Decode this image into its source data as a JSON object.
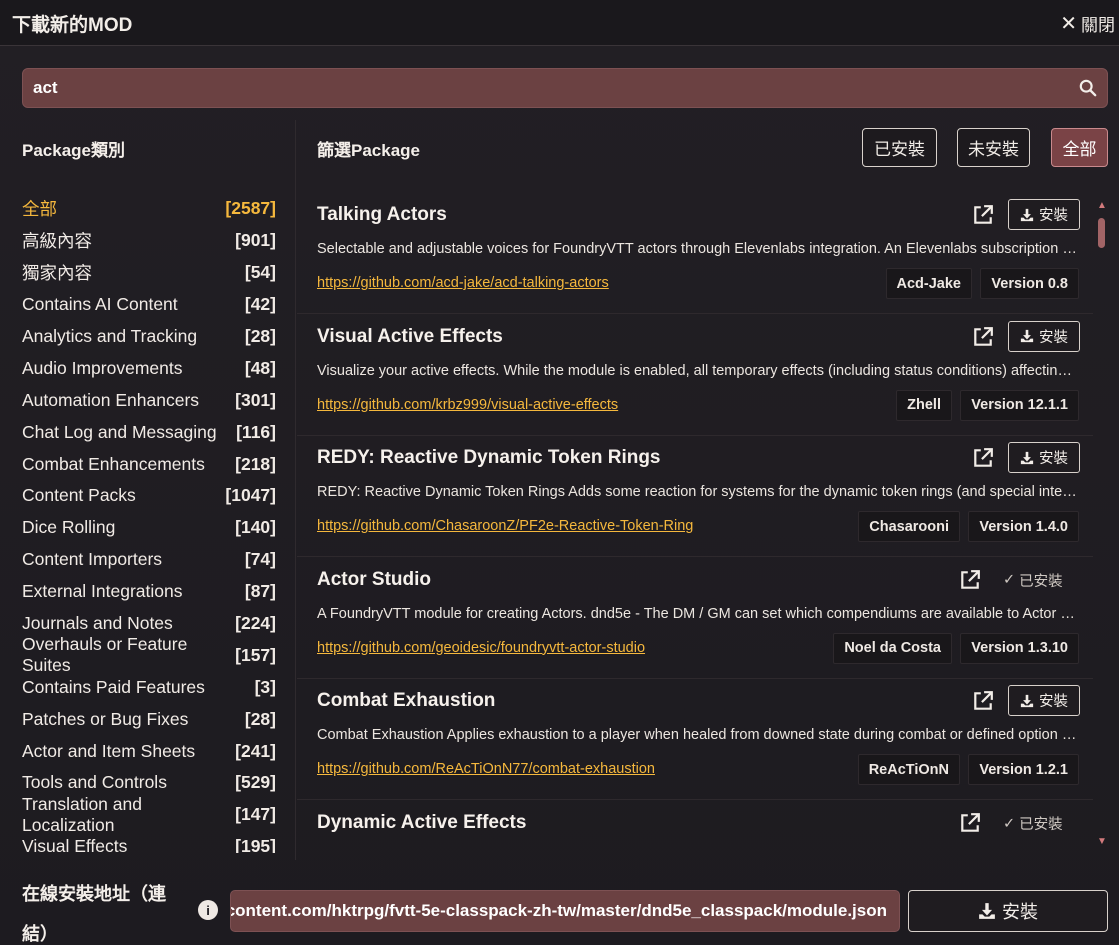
{
  "header": {
    "title": "下載新的MOD",
    "close_label": "關閉"
  },
  "search": {
    "value": "act"
  },
  "left": {
    "heading": "Package類別",
    "categories": [
      {
        "label": "全部",
        "count": "[2587]",
        "active": true
      },
      {
        "label": "高級內容",
        "count": "[901]"
      },
      {
        "label": "獨家內容",
        "count": "[54]"
      },
      {
        "label": "Contains AI Content",
        "count": "[42]"
      },
      {
        "label": "Analytics and Tracking",
        "count": "[28]"
      },
      {
        "label": "Audio Improvements",
        "count": "[48]"
      },
      {
        "label": "Automation Enhancers",
        "count": "[301]"
      },
      {
        "label": "Chat Log and Messaging",
        "count": "[116]"
      },
      {
        "label": "Combat Enhancements",
        "count": "[218]"
      },
      {
        "label": "Content Packs",
        "count": "[1047]"
      },
      {
        "label": "Dice Rolling",
        "count": "[140]"
      },
      {
        "label": "Content Importers",
        "count": "[74]"
      },
      {
        "label": "External Integrations",
        "count": "[87]"
      },
      {
        "label": "Journals and Notes",
        "count": "[224]"
      },
      {
        "label": "Overhauls or Feature Suites",
        "count": "[157]"
      },
      {
        "label": "Contains Paid Features",
        "count": "[3]"
      },
      {
        "label": "Patches or Bug Fixes",
        "count": "[28]"
      },
      {
        "label": "Actor and Item Sheets",
        "count": "[241]"
      },
      {
        "label": "Tools and Controls",
        "count": "[529]"
      },
      {
        "label": "Translation and Localization",
        "count": "[147]"
      },
      {
        "label": "Visual Effects",
        "count": "[195]"
      }
    ]
  },
  "right": {
    "heading": "篩選Package",
    "filters": {
      "installed": "已安裝",
      "not_installed": "未安裝",
      "all": "全部"
    },
    "install_label": "安裝",
    "installed_label": "已安裝",
    "packages": [
      {
        "name": "Talking Actors",
        "description": "Selectable and adjustable voices for FoundryVTT actors through Elevenlabs integration. An Elevenlabs subscription is required.",
        "url": "https://github.com/acd-jake/acd-talking-actors",
        "author": "Acd-Jake",
        "version": "Version 0.8",
        "installed": false
      },
      {
        "name": "Visual Active Effects",
        "description": "Visualize your active effects. While the module is enabled, all temporary effects (including status conditions) affecting the token are shown.",
        "url": "https://github.com/krbz999/visual-active-effects",
        "author": "Zhell",
        "version": "Version 12.1.1",
        "installed": false
      },
      {
        "name": "REDY: Reactive Dynamic Token Rings",
        "description": "REDY: Reactive Dynamic Token Rings Adds some reaction for systems for the dynamic token rings (and special interactions).",
        "url": "https://github.com/ChasaroonZ/PF2e-Reactive-Token-Ring",
        "author": "Chasarooni",
        "version": "Version 1.4.0",
        "installed": false
      },
      {
        "name": "Actor Studio",
        "description": "A FoundryVTT module for creating Actors. dnd5e - The DM / GM can set which compendiums are available to Actor Studio.",
        "url": "https://github.com/geoidesic/foundryvtt-actor-studio",
        "author": "Noel da Costa",
        "version": "Version 1.3.10",
        "installed": true
      },
      {
        "name": "Combat Exhaustion",
        "description": "Combat Exhaustion Applies exhaustion to a player when healed from downed state during combat or defined option settings.",
        "url": "https://github.com/ReAcTiOnN77/combat-exhaustion",
        "author": "ReAcTiOnN",
        "version": "Version 1.2.1",
        "installed": false
      },
      {
        "name": "Dynamic Active Effects",
        "description": "",
        "url": "",
        "author": "",
        "version": "",
        "installed": true
      }
    ]
  },
  "footer": {
    "label": "在線安裝地址（連結）",
    "url_value": "https://raw.githubusercontent.com/hktrpg/fvtt-5e-classpack-zh-tw/master/dnd5e_classpack/module.json",
    "install_label": "安裝"
  }
}
